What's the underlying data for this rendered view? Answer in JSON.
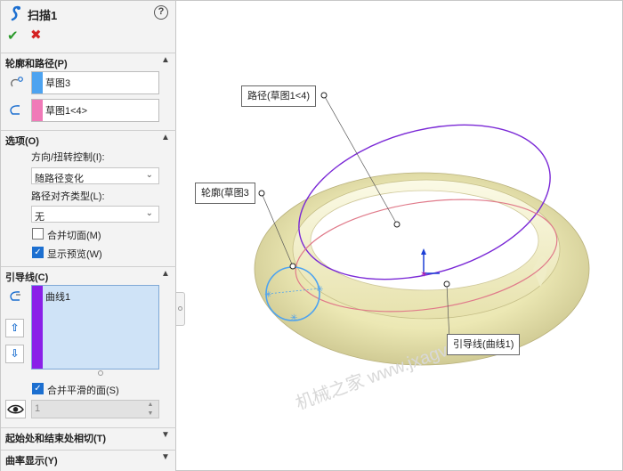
{
  "title": "扫描1",
  "colors": {
    "profile": "#4da3f0",
    "path": "#f07ab8",
    "guide": "#8a1fe8",
    "ok": "#2b9a2b",
    "cancel": "#d42222"
  },
  "sections": {
    "profile_path": {
      "label": "轮廓和路径(P)",
      "profile_item": "草图3",
      "path_item": "草图1<4>"
    },
    "options": {
      "label": "选项(O)",
      "orientation_label": "方向/扭转控制(I):",
      "orientation_value": "随路径变化",
      "alignment_label": "路径对齐类型(L):",
      "alignment_value": "无",
      "merge_tangent": "合并切面(M)",
      "show_preview": "显示预览(W)"
    },
    "guides": {
      "label": "引导线(C)",
      "item": "曲线1",
      "merge_smooth": "合并平滑的面(S)",
      "spin_value": "1"
    },
    "start_end": {
      "label": "起始处和结束处相切(T)"
    },
    "curvature": {
      "label": "曲率显示(Y)"
    }
  },
  "viewport": {
    "callout_path": "路径(草图1<4)",
    "callout_profile": "轮廓(草图3",
    "callout_guide": "引导线(曲线1)",
    "watermark": "机械之家 www.jxagv"
  }
}
